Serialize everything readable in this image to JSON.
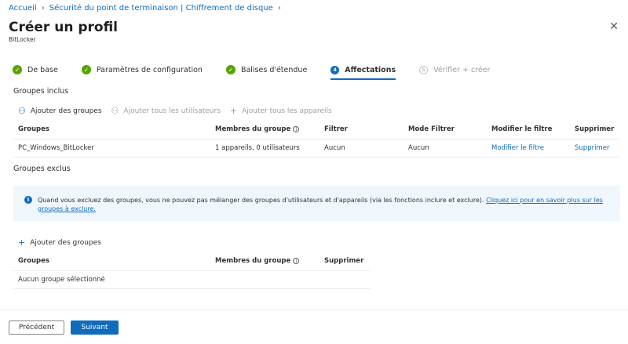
{
  "breadcrumb": [
    "Accueil",
    "Sécurité du point de terminaison | Chiffrement de disque"
  ],
  "title": "Créer un profil",
  "subtitle": "BitLocker",
  "steps": [
    {
      "label": "De base"
    },
    {
      "label": "Paramètres de configuration"
    },
    {
      "label": "Balises d'étendue"
    },
    {
      "num": "4",
      "label": "Affectations"
    },
    {
      "num": "5",
      "label": "Vérifier + créer"
    }
  ],
  "included": {
    "title": "Groupes inclus",
    "add_groups": "Ajouter des groupes",
    "add_all_users": "Ajouter tous les utilisateurs",
    "add_all_devices": "Ajouter tous les appareils",
    "headers": [
      "Groupes",
      "Membres du groupe",
      "Filtrer",
      "Mode Filtrer",
      "Modifier le filtre",
      "Supprimer"
    ],
    "rows": [
      {
        "group": "PC_Windows_BitLocker",
        "members": "1 appareils, 0 utilisateurs",
        "filter": "Aucun",
        "mode": "Aucun",
        "edit": "Modifier le filtre",
        "delete": "Supprimer"
      }
    ]
  },
  "excluded": {
    "title": "Groupes exclus",
    "info": "Quand vous excluez des groupes, vous ne pouvez pas mélanger des groupes d'utilisateurs et d'appareils (via les fonctions inclure et exclure).",
    "info_link": "Cliquez ici pour en savoir plus sur les groupes à exclure.",
    "add_groups": "Ajouter des groupes",
    "headers": [
      "Groupes",
      "Membres du groupe",
      "Supprimer"
    ],
    "empty": "Aucun groupe sélectionné"
  },
  "footer": {
    "previous": "Précédent",
    "next": "Suivant"
  }
}
